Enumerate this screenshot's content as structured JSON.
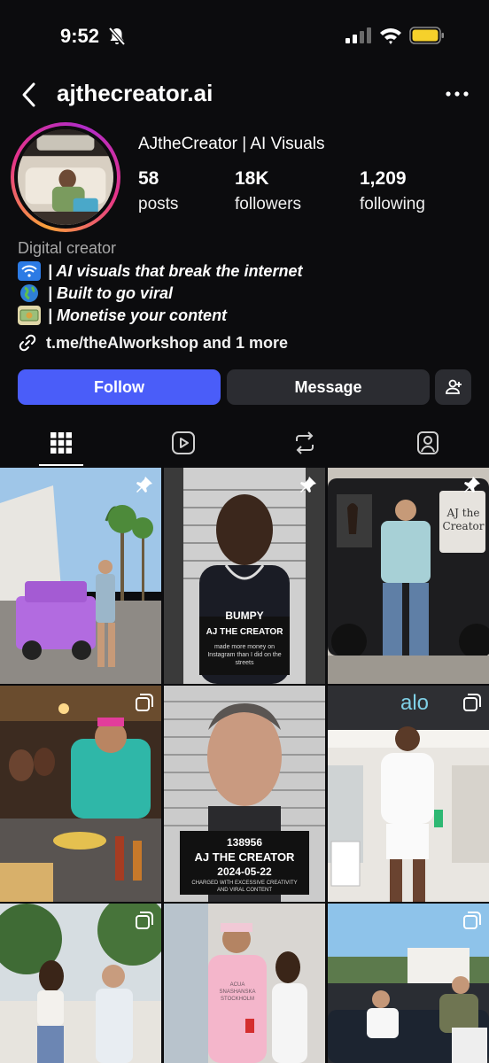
{
  "status_bar": {
    "time": "9:52"
  },
  "header": {
    "username": "ajthecreator.ai"
  },
  "profile": {
    "display_name": "AJtheCreator | AI Visuals",
    "stats": [
      {
        "value": "58",
        "label": "posts"
      },
      {
        "value": "18K",
        "label": "followers"
      },
      {
        "value": "1,209",
        "label": "following"
      }
    ],
    "category": "Digital creator",
    "bio": [
      {
        "emoji": "wifi-emoji",
        "text": "| AI visuals that break the internet"
      },
      {
        "emoji": "globe-emoji",
        "text": "| Built to go viral"
      },
      {
        "emoji": "money-emoji",
        "text": "| Monetise your content"
      }
    ],
    "link": "t.me/theAIworkshop and 1 more"
  },
  "actions": {
    "follow": "Follow",
    "message": "Message"
  },
  "tabs": [
    "grid-icon",
    "reels-icon",
    "reposts-icon",
    "tagged-icon"
  ],
  "posts": [
    {
      "name": "post-purple-gwagon",
      "badge": "pin-icon"
    },
    {
      "name": "post-mugshot-bumpy",
      "badge": "pin-icon",
      "sign_title": "BUMPY",
      "sign_name": "AJ THE CREATOR",
      "sign_text": "made more money on Instagram than I did on the streets"
    },
    {
      "name": "post-gwagon-ajthecreator",
      "badge": "pin-icon",
      "window_text": "AJ the Creator"
    },
    {
      "name": "post-street-food",
      "badge": "carousel-icon"
    },
    {
      "name": "post-mugshot-tattoo",
      "badge": "",
      "sign_id": "138956",
      "sign_name": "AJ THE CREATOR",
      "sign_date": "2024-05-22",
      "sign_text": "CHARGED WITH EXCESSIVE CREATIVITY AND VIRAL CONTENT"
    },
    {
      "name": "post-alo-store",
      "badge": "carousel-icon",
      "store_text": "alo"
    },
    {
      "name": "post-couple-mansion",
      "badge": "carousel-icon"
    },
    {
      "name": "post-pink-hoodie",
      "badge": "",
      "shirt_text": "ACUA SNASHANSKA STOCKHOLM"
    },
    {
      "name": "post-car-hollywood",
      "badge": "carousel-icon"
    }
  ],
  "colors": {
    "accent": "#4a5df9",
    "background": "#0c0c0e",
    "button_dark": "#2b2c31",
    "battery": "#f6d12b"
  }
}
